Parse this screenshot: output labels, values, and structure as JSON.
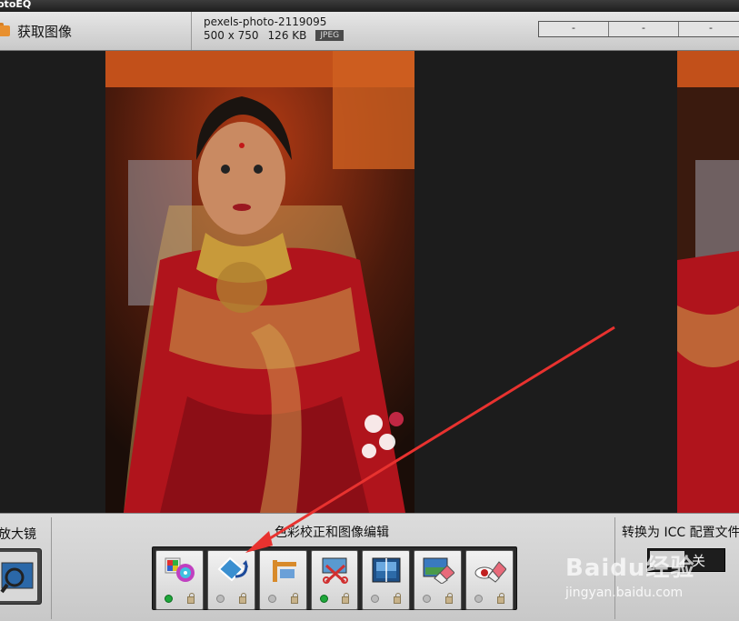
{
  "app": {
    "title_fragment": "otoEQ"
  },
  "toolbar": {
    "acquire_label": "获取图像",
    "file_name": "pexels-photo-2119095",
    "dimensions": "500 x 750",
    "file_size": "126 KB",
    "file_type": "JPEG",
    "segments": [
      "-",
      "-",
      "-"
    ]
  },
  "bottom": {
    "magnifier_label": "放大镜",
    "section_title": "色彩校正和图像编辑",
    "icc_label": "转换为 ICC 配置文件",
    "toggle_state": "关",
    "tools": [
      {
        "icon": "color-wheel-icon",
        "active": true
      },
      {
        "icon": "rotate-straighten-icon",
        "active": false
      },
      {
        "icon": "crop-icon",
        "active": false
      },
      {
        "icon": "resize-scissors-icon",
        "active": true
      },
      {
        "icon": "frame-icon",
        "active": false
      },
      {
        "icon": "retouch-eraser-icon",
        "active": false
      },
      {
        "icon": "redeye-eraser-icon",
        "active": false
      }
    ]
  },
  "watermark": {
    "brand": "Baidu经验",
    "url": "jingyan.baidu.com"
  },
  "colors": {
    "accent_arrow": "#e8322f",
    "toolbar_bg": "#d6d6d6",
    "viewer_bg": "#1c1c1c"
  }
}
